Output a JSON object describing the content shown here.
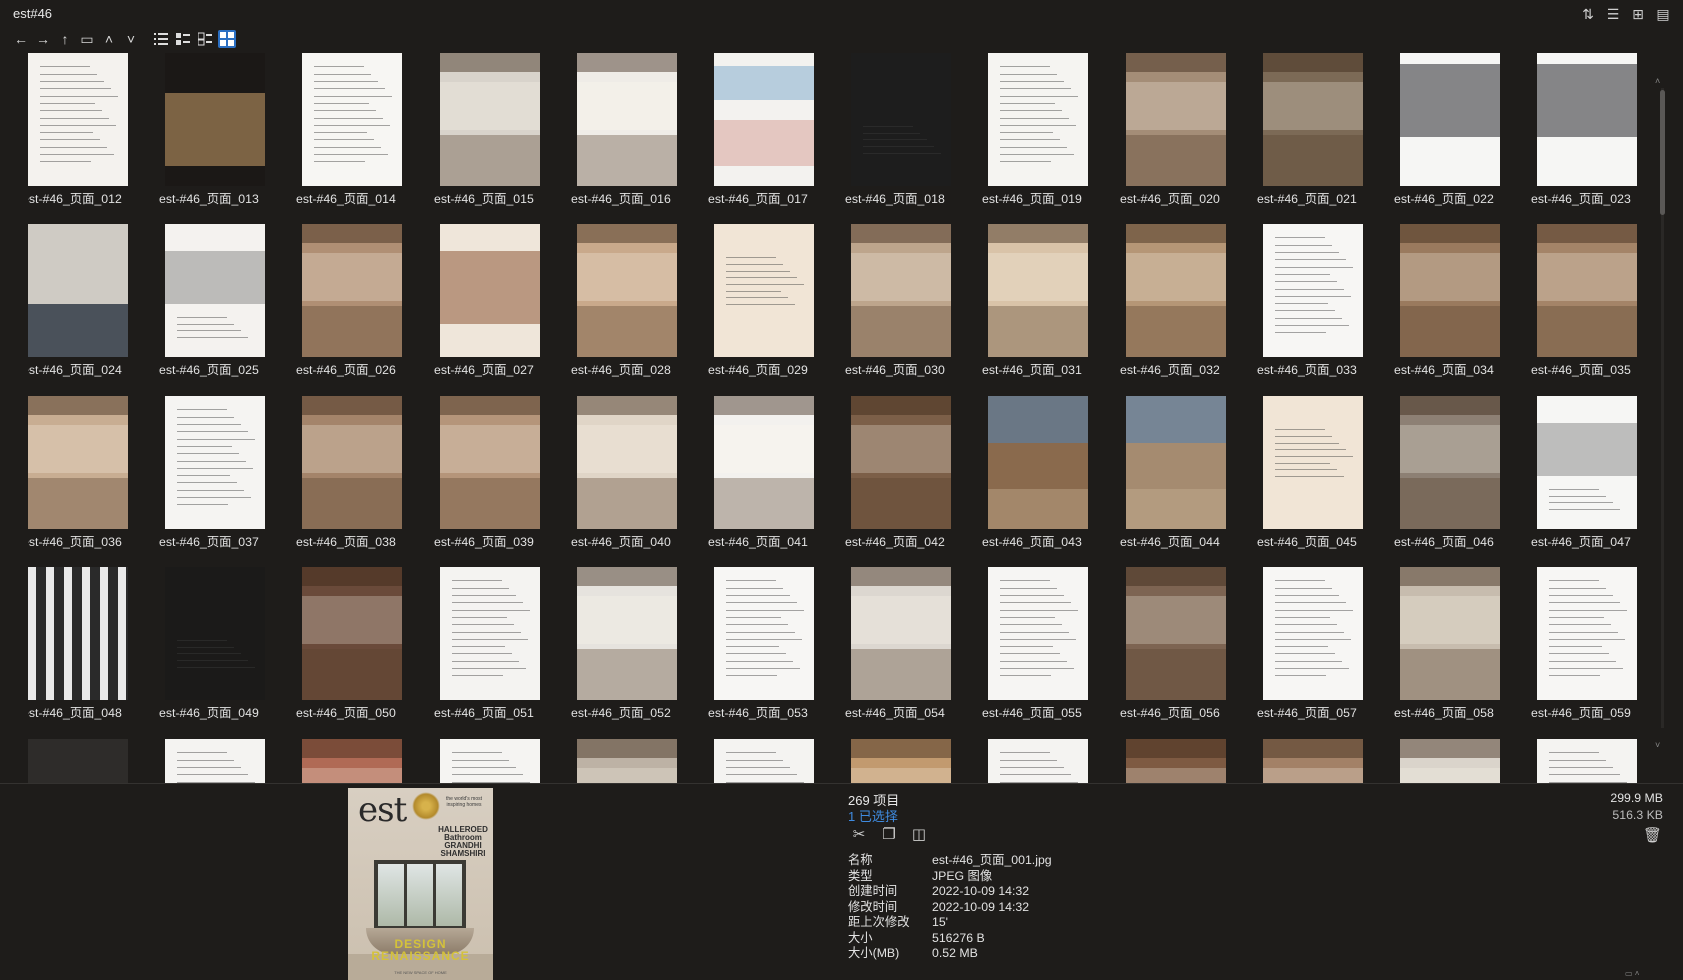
{
  "window": {
    "title": "est#46",
    "icons": [
      "sort-icon",
      "details-view-icon",
      "new-window-icon",
      "clipboard-icon"
    ]
  },
  "toolbar": {
    "icons": [
      "back-arrow-icon",
      "forward-arrow-icon",
      "up-arrow-icon",
      "folder-icon",
      "chevron-up-icon",
      "chevron-down-icon",
      "list-view-icon",
      "detail-list-view-icon",
      "tile-view-icon",
      "thumbnail-view-icon"
    ],
    "active_view": "thumbnail-view-icon"
  },
  "files": [
    {
      "name": "est-#46_页面_012",
      "bg": "#f4f2ee",
      "kind": "text"
    },
    {
      "name": "est-#46_页面_013",
      "bg": "#1b1816",
      "kind": "chair"
    },
    {
      "name": "est-#46_页面_014",
      "bg": "#f7f6f3",
      "kind": "text"
    },
    {
      "name": "est-#46_页面_015",
      "bg": "#d8d3cb",
      "kind": "room"
    },
    {
      "name": "est-#46_页面_016",
      "bg": "#efece7",
      "kind": "room"
    },
    {
      "name": "est-#46_页面_017",
      "bg": "#f3f2ef",
      "kind": "collage"
    },
    {
      "name": "est-#46_页面_018",
      "bg": "#1d1d1d",
      "kind": "dark"
    },
    {
      "name": "est-#46_页面_019",
      "bg": "#f5f4f1",
      "kind": "text"
    },
    {
      "name": "est-#46_页面_020",
      "bg": "#a48d77",
      "kind": "room"
    },
    {
      "name": "est-#46_页面_021",
      "bg": "#7c6a56",
      "kind": "room"
    },
    {
      "name": "est-#46_页面_022",
      "bg": "#f6f6f4",
      "kind": "fashion"
    },
    {
      "name": "est-#46_页面_023",
      "bg": "#f6f6f4",
      "kind": "fashion"
    },
    {
      "name": "est-#46_页面_024",
      "bg": "#cfcbc4",
      "kind": "kitchen"
    },
    {
      "name": "est-#46_页面_025",
      "bg": "#f4f2ef",
      "kind": "product"
    },
    {
      "name": "est-#46_页面_026",
      "bg": "#b08f74",
      "kind": "room"
    },
    {
      "name": "est-#46_页面_027",
      "bg": "#efe6da",
      "kind": "poster"
    },
    {
      "name": "est-#46_页面_028",
      "bg": "#c9a98b",
      "kind": "room"
    },
    {
      "name": "est-#46_页面_029",
      "bg": "#f1e5d6",
      "kind": "quote"
    },
    {
      "name": "est-#46_页面_030",
      "bg": "#bda58c",
      "kind": "room"
    },
    {
      "name": "est-#46_页面_031",
      "bg": "#d9c3a8",
      "kind": "room"
    },
    {
      "name": "est-#46_页面_032",
      "bg": "#b59676",
      "kind": "room"
    },
    {
      "name": "est-#46_页面_033",
      "bg": "#f7f6f4",
      "kind": "text"
    },
    {
      "name": "est-#46_页面_034",
      "bg": "#9a7a5e",
      "kind": "room"
    },
    {
      "name": "est-#46_页面_035",
      "bg": "#a48468",
      "kind": "room"
    },
    {
      "name": "est-#46_页面_036",
      "bg": "#c8ad92",
      "kind": "room"
    },
    {
      "name": "est-#46_页面_037",
      "bg": "#f5f4f2",
      "kind": "text"
    },
    {
      "name": "est-#46_页面_038",
      "bg": "#a4846a",
      "kind": "room"
    },
    {
      "name": "est-#46_页面_039",
      "bg": "#b5957a",
      "kind": "room"
    },
    {
      "name": "est-#46_页面_040",
      "bg": "#e0d5c7",
      "kind": "room"
    },
    {
      "name": "est-#46_页面_041",
      "bg": "#f3f1ee",
      "kind": "room"
    },
    {
      "name": "est-#46_页面_042",
      "bg": "#7c5f48",
      "kind": "room"
    },
    {
      "name": "est-#46_页面_043",
      "bg": "#8a6a4d",
      "kind": "landscape"
    },
    {
      "name": "est-#46_页面_044",
      "bg": "#a58b70",
      "kind": "landscape"
    },
    {
      "name": "est-#46_页面_045",
      "bg": "#f1e5d6",
      "kind": "quote"
    },
    {
      "name": "est-#46_页面_046",
      "bg": "#8d8074",
      "kind": "room"
    },
    {
      "name": "est-#46_页面_047",
      "bg": "#f6f6f4",
      "kind": "product"
    },
    {
      "name": "est-#46_页面_048",
      "bg": "#2a2a2a",
      "kind": "stripes"
    },
    {
      "name": "est-#46_页面_049",
      "bg": "#1b1a19",
      "kind": "dark"
    },
    {
      "name": "est-#46_页面_050",
      "bg": "#6a4a3a",
      "kind": "room"
    },
    {
      "name": "est-#46_页面_051",
      "bg": "#f4f3f1",
      "kind": "text"
    },
    {
      "name": "est-#46_页面_052",
      "bg": "#e6e3de",
      "kind": "room"
    },
    {
      "name": "est-#46_页面_053",
      "bg": "#f7f6f4",
      "kind": "text"
    },
    {
      "name": "est-#46_页面_054",
      "bg": "#dcd7d0",
      "kind": "room"
    },
    {
      "name": "est-#46_页面_055",
      "bg": "#f6f5f3",
      "kind": "text"
    },
    {
      "name": "est-#46_页面_056",
      "bg": "#7d6452",
      "kind": "room"
    },
    {
      "name": "est-#46_页面_057",
      "bg": "#f7f6f4",
      "kind": "text"
    },
    {
      "name": "est-#46_页面_058",
      "bg": "#c7bcae",
      "kind": "room"
    },
    {
      "name": "est-#46_页面_059",
      "bg": "#f7f6f4",
      "kind": "text"
    },
    {
      "name": "",
      "bg": "#2e2c2a",
      "kind": "dark"
    },
    {
      "name": "",
      "bg": "#f4f3f1",
      "kind": "text"
    },
    {
      "name": "",
      "bg": "#b06a55",
      "kind": "room"
    },
    {
      "name": "",
      "bg": "#f5f4f2",
      "kind": "text"
    },
    {
      "name": "",
      "bg": "#bdb2a5",
      "kind": "room"
    },
    {
      "name": "",
      "bg": "#f4f3f1",
      "kind": "text"
    },
    {
      "name": "",
      "bg": "#c29a6f",
      "kind": "room"
    },
    {
      "name": "",
      "bg": "#f4f3f1",
      "kind": "text"
    },
    {
      "name": "",
      "bg": "#7e5a42",
      "kind": "room"
    },
    {
      "name": "",
      "bg": "#a38167",
      "kind": "room"
    },
    {
      "name": "",
      "bg": "#dad4cb",
      "kind": "room"
    },
    {
      "name": "",
      "bg": "#f4f3f1",
      "kind": "text"
    }
  ],
  "preview": {
    "logo": "est",
    "tagline": "the world's most inspiring homes",
    "name_lines": "HALLEROED Bathroom GRANDHI SHAMSHIRI",
    "title_lines": "DESIGN RENAISSANCE",
    "subtitle": "THE NEW SPACE OF HOME"
  },
  "info": {
    "item_count": "269 项目",
    "selected": "1 已选择",
    "total_size": "299.9 MB",
    "selected_size": "516.3 KB",
    "action_icons": [
      "scissors-icon",
      "copy-icon",
      "compare-icon"
    ],
    "properties": [
      {
        "key": "名称",
        "value": "est-#46_页面_001.jpg"
      },
      {
        "key": "类型",
        "value": "JPEG 图像"
      },
      {
        "key": "创建时间",
        "value": "2022-10-09  14:32"
      },
      {
        "key": "修改时间",
        "value": "2022-10-09  14:32"
      },
      {
        "key": "距上次修改",
        "value": "15'"
      },
      {
        "key": "大小",
        "value": "516276 B"
      },
      {
        "key": "大小(MB)",
        "value": "0.52 MB"
      }
    ]
  }
}
